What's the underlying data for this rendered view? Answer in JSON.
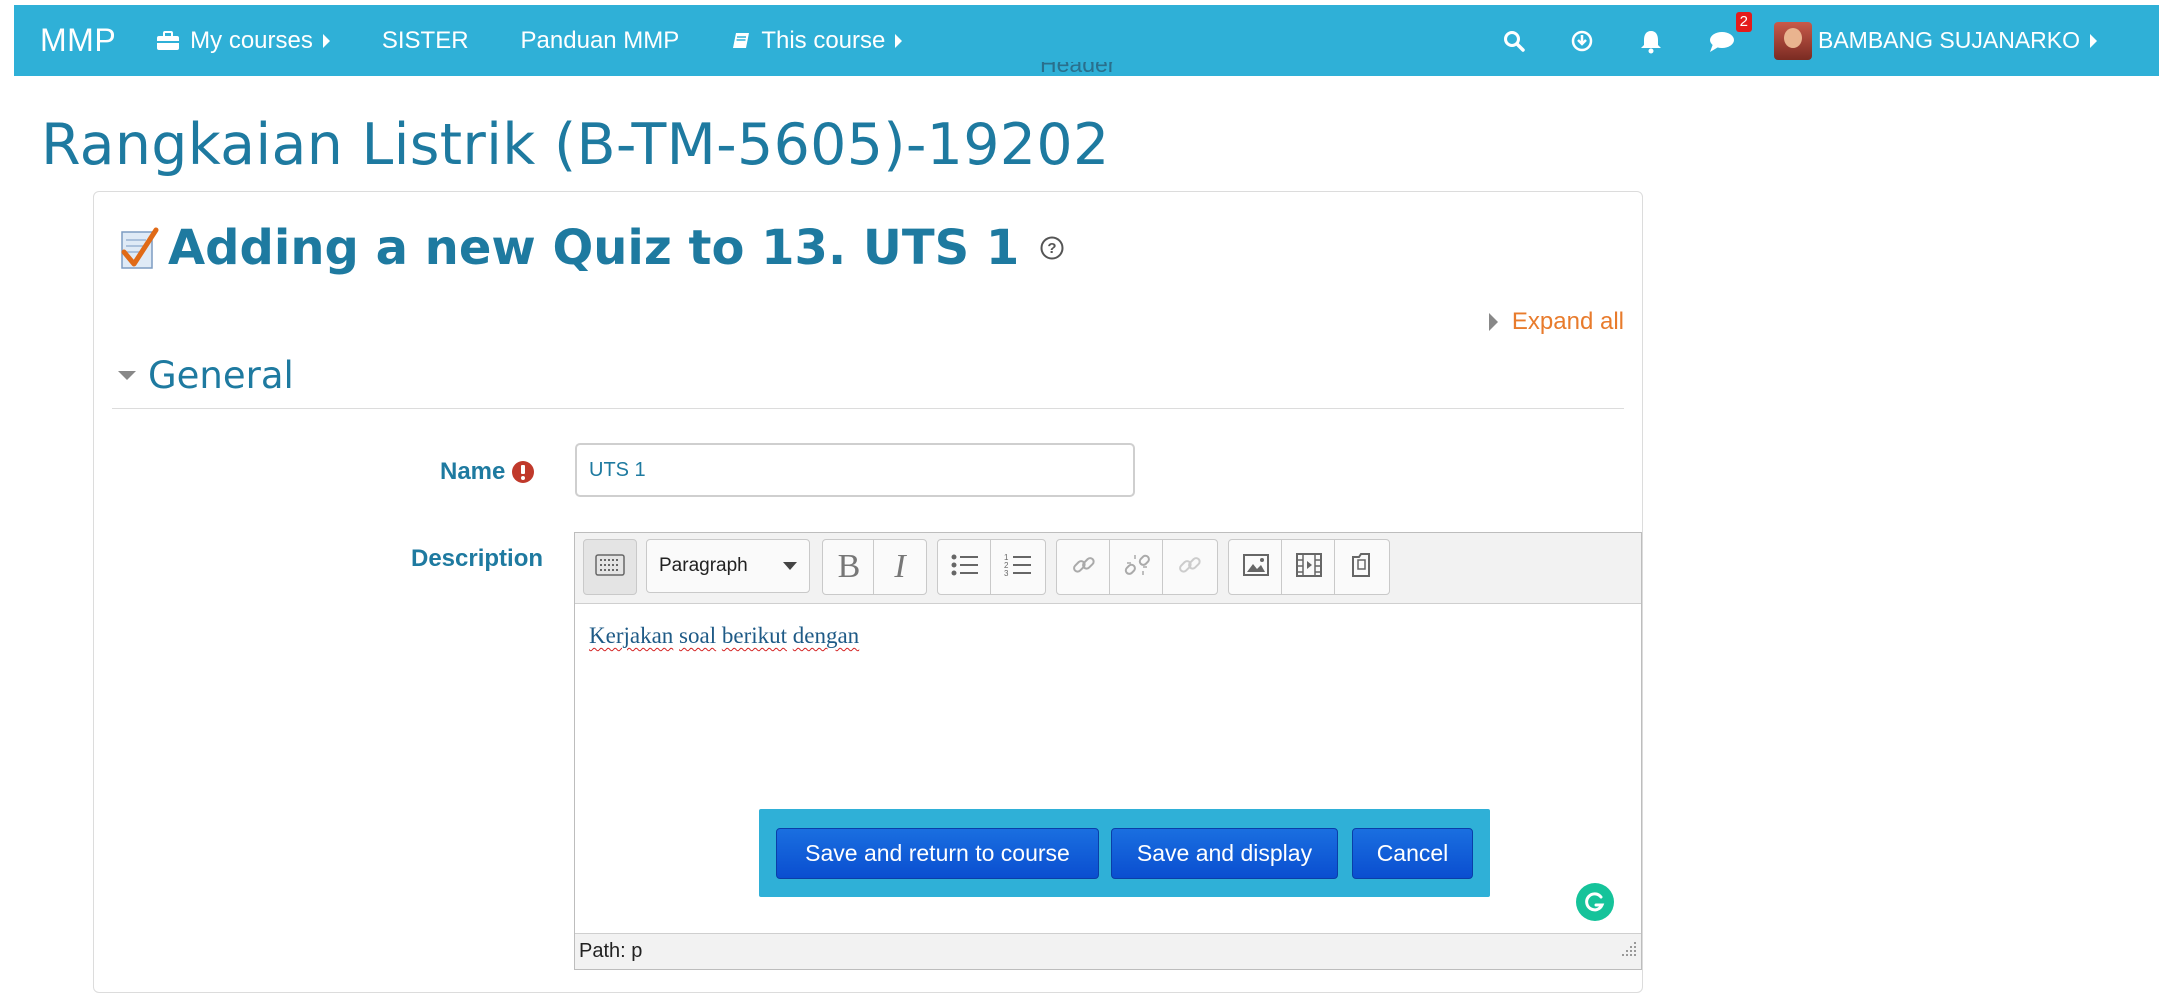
{
  "navbar": {
    "brand": "MMP",
    "items": [
      {
        "label": "My courses",
        "icon": "briefcase-icon"
      },
      {
        "label": "SISTER"
      },
      {
        "label": "Panduan MMP"
      },
      {
        "label": "This course",
        "icon": "book-icon"
      }
    ],
    "notification_count": "2",
    "user_name": "BAMBANG SUJANARKO"
  },
  "header_text": "Header",
  "page_title": "Rangkaian Listrik (B-TM-5605)-19202",
  "form": {
    "heading": "Adding a new Quiz to 13. UTS 1",
    "expand_all": "Expand all",
    "section": "General",
    "name_label": "Name",
    "name_value": "UTS 1",
    "description_label": "Description",
    "editor": {
      "format": "Paragraph",
      "bold": "B",
      "italic": "I",
      "content_words": [
        "Kerjakan",
        "soal",
        "berikut",
        "dengan"
      ],
      "path": "Path: p"
    }
  },
  "buttons": {
    "save_return": "Save and return to course",
    "save_display": "Save and display",
    "cancel": "Cancel"
  },
  "colors": {
    "navbar": "#2fb0d7",
    "heading": "#1e7aa0",
    "link": "#e87b2c",
    "primary_button": "#0a4ed0",
    "required": "#c0392b"
  }
}
